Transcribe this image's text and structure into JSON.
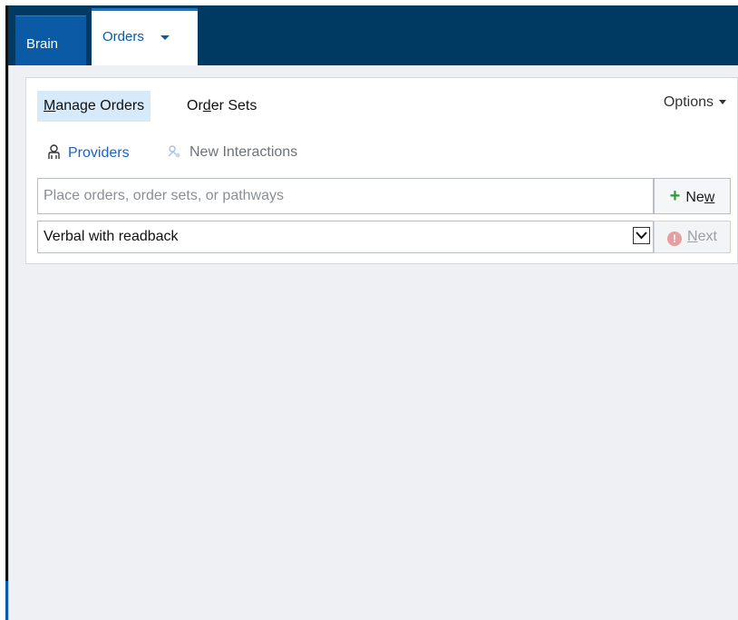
{
  "tabs": {
    "brain": {
      "label": "Brain"
    },
    "orders": {
      "label": "Orders"
    }
  },
  "actions": {
    "manage_orders": {
      "before": "",
      "underlined": "M",
      "after": "anage Orders"
    },
    "order_sets": {
      "before": "Or",
      "underlined": "d",
      "after": "er Sets"
    },
    "options": {
      "label": "Options"
    }
  },
  "links": {
    "providers": "Providers",
    "new_interactions": "New Interactions"
  },
  "order_entry": {
    "placeholder": "Place orders, order sets, or pathways",
    "new_button": {
      "before": "Ne",
      "underlined": "w",
      "after": ""
    }
  },
  "order_mode": {
    "selected_value": "Verbal with readback",
    "next_button": {
      "before": "",
      "underlined": "N",
      "after": "ext"
    },
    "warning_glyph": "!"
  },
  "colors": {
    "header_bg": "#003a63",
    "brain_tab_bg": "#0b5aa6",
    "link_blue": "#1b62c4",
    "new_plus_green": "#2e9a3a"
  },
  "icons": {
    "providers": "person-icon",
    "new_interactions": "interactions-icon",
    "new": "plus-icon",
    "next": "warning-circle-icon",
    "dropdown": "chevron-down-icon",
    "orders_tab": "caret-down-icon",
    "options": "caret-down-icon"
  }
}
